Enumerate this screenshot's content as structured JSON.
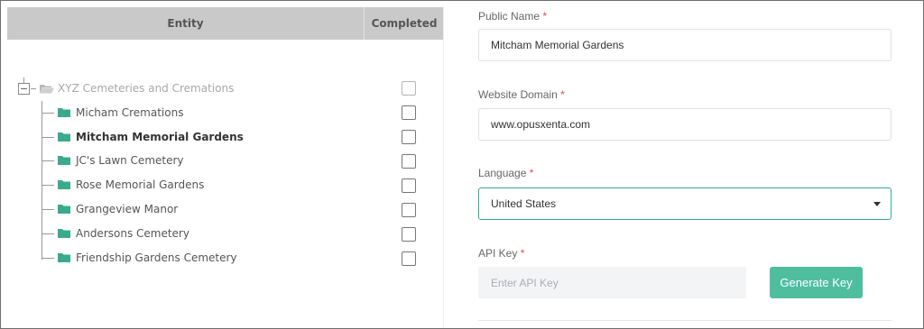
{
  "table": {
    "entity_header": "Entity",
    "completed_header": "Completed"
  },
  "tree": {
    "root": {
      "label": "XYZ Cemeteries and Cremations",
      "folder_icon": "folder-open-icon"
    },
    "children": [
      {
        "label": "Micham Cremations",
        "bold": false
      },
      {
        "label": "Mitcham Memorial Gardens",
        "bold": true
      },
      {
        "label": "JC's Lawn Cemetery",
        "bold": false
      },
      {
        "label": "Rose Memorial Gardens",
        "bold": false
      },
      {
        "label": "Grangeview Manor",
        "bold": false
      },
      {
        "label": "Andersons Cemetery",
        "bold": false
      },
      {
        "label": "Friendship Gardens Cemetery",
        "bold": false
      }
    ]
  },
  "form": {
    "public_name": {
      "label": "Public Name",
      "required": "*",
      "value": "Mitcham Memorial Gardens"
    },
    "website_domain": {
      "label": "Website Domain",
      "required": "*",
      "value": "www.opusxenta.com"
    },
    "language": {
      "label": "Language",
      "required": "*",
      "value": "United States"
    },
    "api_key": {
      "label": "API Key",
      "required": "*",
      "placeholder": "Enter API Key"
    },
    "generate_key_label": "Generate Key"
  },
  "colors": {
    "accent": "#4fbe9f",
    "folder": "#3aaa8e",
    "required": "#e04a4a",
    "header_bg": "#c9c9c9"
  }
}
